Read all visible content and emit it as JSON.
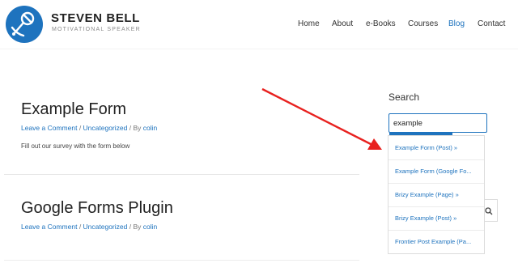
{
  "brand": {
    "name": "STEVEN BELL",
    "tagline": "MOTIVATIONAL SPEAKER"
  },
  "nav": {
    "home": "Home",
    "about": "About",
    "ebooks": "e-Books",
    "courses": "Courses",
    "blog": "Blog",
    "contact": "Contact",
    "active": "Blog"
  },
  "posts": [
    {
      "title": "Example Form",
      "comment": "Leave a Comment",
      "sep1": " / ",
      "category": "Uncategorized",
      "by": " / By ",
      "author": "colin",
      "excerpt": "Fill out our survey with the form below"
    },
    {
      "title": "Google Forms Plugin",
      "comment": "Leave a Comment",
      "sep1": " / ",
      "category": "Uncategorized",
      "by": " / By ",
      "author": "colin"
    }
  ],
  "sidebar": {
    "search_label": "Search",
    "search_value": "example",
    "suggestions": [
      "Example Form (Post) »",
      "Example Form (Google Fo...",
      "Brizy Example (Page) »",
      "Brizy Example (Post) »",
      "Frontier Post Example (Pa..."
    ]
  },
  "colors": {
    "accent": "#1e73be",
    "annotation_arrow": "#e8211f",
    "logo": "#1e73be"
  },
  "icons": {
    "logo": "microphone-logo-icon",
    "search": "search-icon",
    "arrow": "annotation-arrow-icon"
  }
}
